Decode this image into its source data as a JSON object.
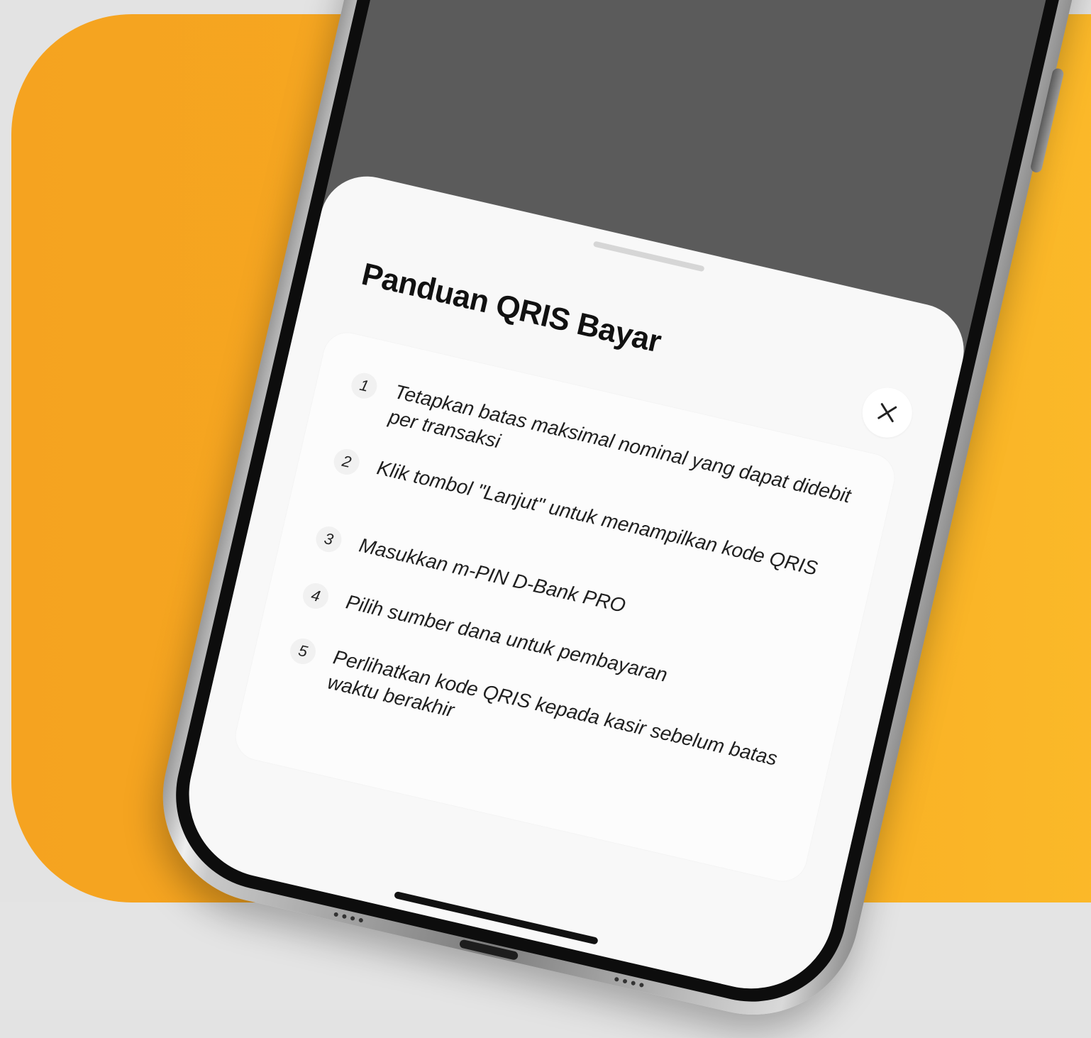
{
  "sheet": {
    "title": "Panduan QRIS Bayar",
    "close_icon": "close-icon"
  },
  "steps": [
    {
      "number": "1",
      "text": "Tetapkan batas maksimal nominal yang dapat didebit per transaksi"
    },
    {
      "number": "2",
      "text": "Klik tombol \"Lanjut\" untuk menampilkan kode QRIS"
    },
    {
      "number": "3",
      "text": "Masukkan m-PIN D-Bank PRO"
    },
    {
      "number": "4",
      "text": "Pilih sumber dana untuk pembayaran"
    },
    {
      "number": "5",
      "text": "Perlihatkan kode QRIS kepada kasir sebelum batas waktu berakhir"
    }
  ],
  "colors": {
    "background_orange": "#f5a320",
    "background_yellow": "#fbb929",
    "screen_overlay": "#5b5b5b",
    "sheet_background": "#f8f8f8"
  }
}
